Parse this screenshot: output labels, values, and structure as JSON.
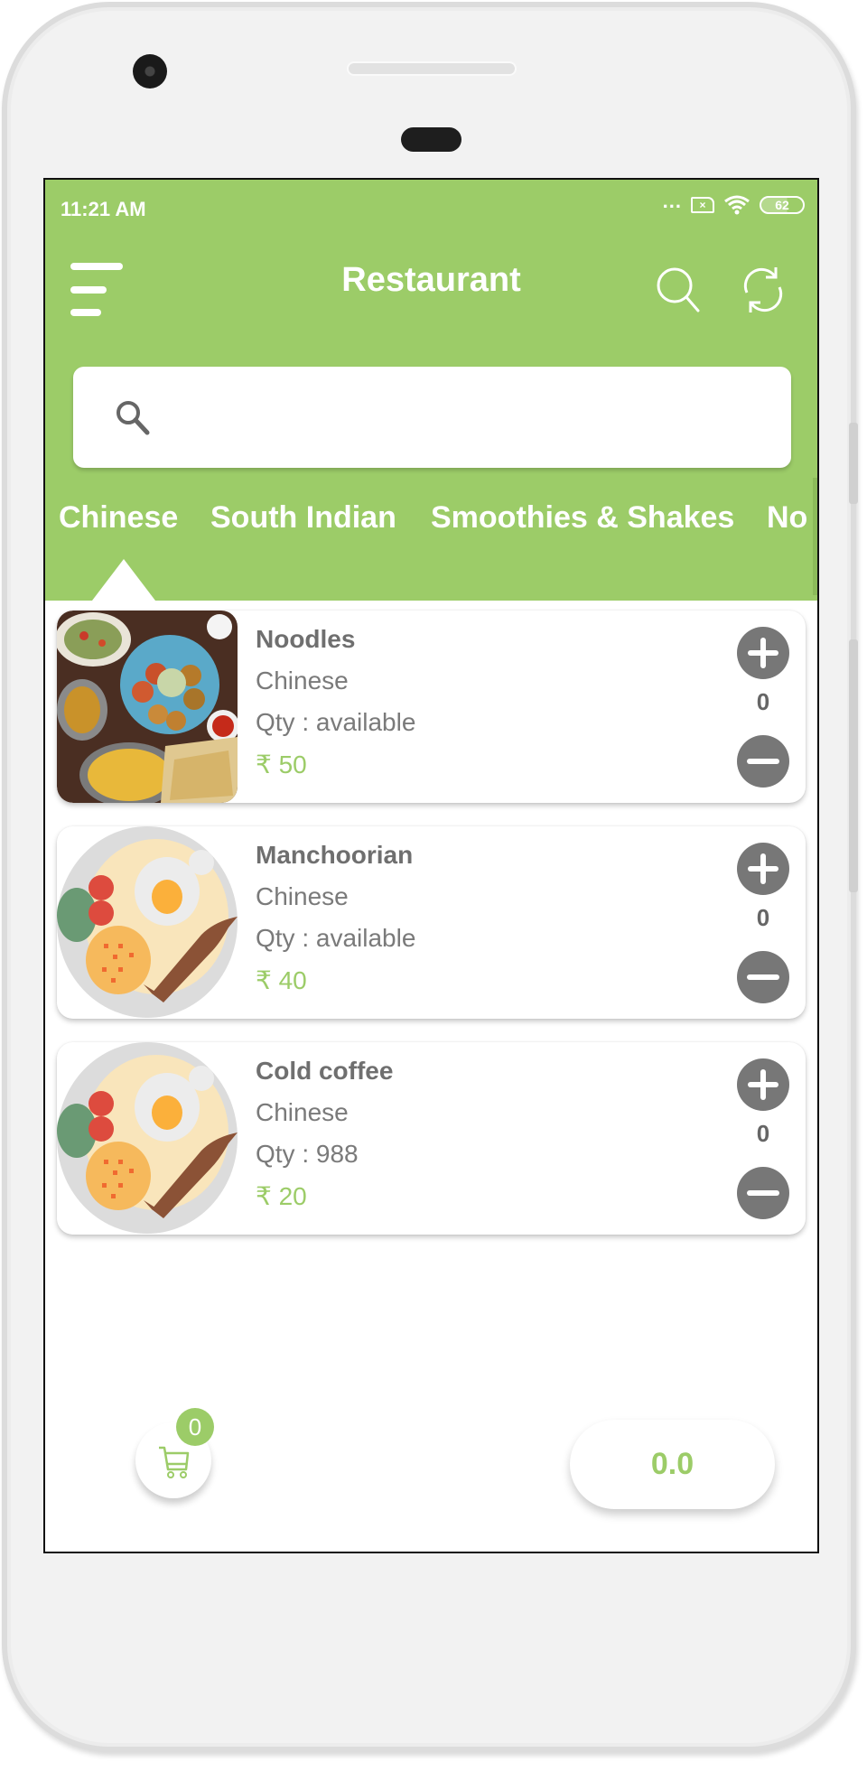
{
  "status_bar": {
    "time": "11:21 AM",
    "signal_dots": "...",
    "sim_icon": "no-sim-icon",
    "wifi_icon": "wifi-icon",
    "battery_level": "62"
  },
  "toolbar": {
    "title": "Restaurant",
    "menu_icon": "hamburger-menu-icon",
    "search_icon": "search-icon",
    "refresh_icon": "refresh-icon"
  },
  "search": {
    "placeholder": "",
    "value": ""
  },
  "tabs": [
    {
      "label": "Chinese",
      "selected": true
    },
    {
      "label": "South Indian",
      "selected": false
    },
    {
      "label": "Smoothies & Shakes",
      "selected": false
    },
    {
      "label": "No",
      "selected": false
    }
  ],
  "items": [
    {
      "name": "Noodles",
      "category": "Chinese",
      "qty": "Qty : available",
      "price": "₹ 50",
      "count": "0",
      "image": "food-spread-photo"
    },
    {
      "name": "Manchoorian",
      "category": "Chinese",
      "qty": "Qty : available",
      "price": "₹ 40",
      "count": "0",
      "image": "food-plate-illustration"
    },
    {
      "name": "Cold coffee",
      "category": "Chinese",
      "qty": "Qty : 988",
      "price": "₹ 20",
      "count": "0",
      "image": "food-plate-illustration"
    }
  ],
  "cart": {
    "badge_count": "0",
    "total": "0.0"
  },
  "colors": {
    "brand_green": "#9ccc68",
    "button_gray": "#777777",
    "text_gray": "#6f6f6f"
  }
}
